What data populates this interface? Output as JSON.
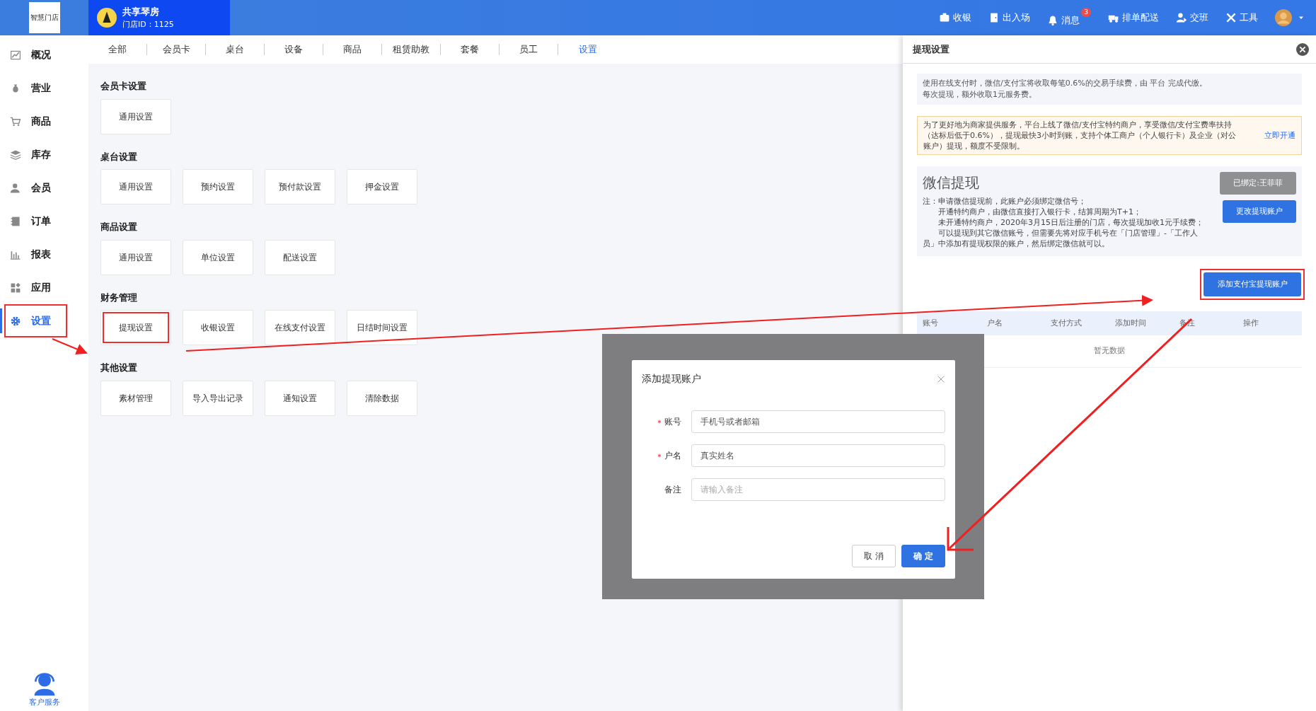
{
  "header": {
    "logo": "智慧门店",
    "store_name": "共享琴房",
    "store_id": "门店ID：1125",
    "tools": [
      {
        "label": "收银"
      },
      {
        "label": "出入场"
      },
      {
        "label": "消息",
        "badge": "3"
      },
      {
        "label": "排单配送"
      },
      {
        "label": "交班"
      },
      {
        "label": "工具"
      }
    ]
  },
  "sidebar": {
    "items": [
      {
        "label": "概况",
        "selected": false,
        "highlighted": false
      },
      {
        "label": "营业",
        "selected": false,
        "highlighted": false
      },
      {
        "label": "商品",
        "selected": false,
        "highlighted": false
      },
      {
        "label": "库存",
        "selected": false,
        "highlighted": false
      },
      {
        "label": "会员",
        "selected": false,
        "highlighted": false
      },
      {
        "label": "订单",
        "selected": false,
        "highlighted": false
      },
      {
        "label": "报表",
        "selected": false,
        "highlighted": false
      },
      {
        "label": "应用",
        "selected": false,
        "highlighted": false
      },
      {
        "label": "设置",
        "selected": true,
        "highlighted": true
      }
    ],
    "support": "客户服务"
  },
  "tabs": [
    {
      "label": "全部",
      "selected": false
    },
    {
      "label": "会员卡",
      "selected": false
    },
    {
      "label": "桌台",
      "selected": false
    },
    {
      "label": "设备",
      "selected": false
    },
    {
      "label": "商品",
      "selected": false
    },
    {
      "label": "租赁助教",
      "selected": false
    },
    {
      "label": "套餐",
      "selected": false
    },
    {
      "label": "员工",
      "selected": false
    },
    {
      "label": "设置",
      "selected": true
    }
  ],
  "sections": [
    {
      "title": "会员卡设置",
      "buttons": [
        {
          "label": "通用设置",
          "highlighted": false
        }
      ]
    },
    {
      "title": "桌台设置",
      "buttons": [
        {
          "label": "通用设置",
          "highlighted": false
        },
        {
          "label": "预约设置",
          "highlighted": false
        },
        {
          "label": "预付款设置",
          "highlighted": false
        },
        {
          "label": "押金设置",
          "highlighted": false
        }
      ]
    },
    {
      "title": "商品设置",
      "buttons": [
        {
          "label": "通用设置",
          "highlighted": false
        },
        {
          "label": "单位设置",
          "highlighted": false
        },
        {
          "label": "配送设置",
          "highlighted": false
        }
      ]
    },
    {
      "title": "财务管理",
      "buttons": [
        {
          "label": "提现设置",
          "highlighted": true
        },
        {
          "label": "收银设置",
          "highlighted": false
        },
        {
          "label": "在线支付设置",
          "highlighted": false
        },
        {
          "label": "日结时间设置",
          "highlighted": false
        }
      ]
    },
    {
      "title": "其他设置",
      "buttons": [
        {
          "label": "素材管理",
          "highlighted": false
        },
        {
          "label": "导入导出记录",
          "highlighted": false
        },
        {
          "label": "通知设置",
          "highlighted": false
        },
        {
          "label": "清除数据",
          "highlighted": false
        }
      ]
    }
  ],
  "drawer": {
    "title": "提现设置",
    "notice": [
      "使用在线支付时，微信/支付宝将收取每笔0.6%的交易手续费，由 平台 完成代缴。",
      "每次提现，额外收取1元服务费。"
    ],
    "promo": {
      "text": "为了更好地为商家提供服务，平台上线了微信/支付宝特约商户，享受微信/支付宝费率扶持（达标后低于0.6%），提现最快3小时到账，支持个体工商户（个人银行卡）及企业（对公账户）提现，额度不受限制。",
      "link": "立即开通"
    },
    "wechat": {
      "title": "微信提现",
      "notes": [
        "注：申请微信提现前，此账户必须绑定微信号；",
        "开通特约商户，由微信直接打入银行卡，结算周期为T+1；",
        "未开通特约商户，2020年3月15日后注册的门店，每次提现加收1元手续费；",
        "可以提现到其它微信账号，但需要先将对应手机号在「门店管理」-「工作人员」中添加有提现权限的账户，然后绑定微信就可以。"
      ],
      "bound_button": "已绑定:王菲菲",
      "change_button": "更改提现账户"
    },
    "add_button": {
      "label": "添加支付宝提现账户",
      "highlighted": true
    },
    "table": {
      "columns": [
        "账号",
        "户名",
        "支付方式",
        "添加时间",
        "备注",
        "操作"
      ],
      "empty": "暂无数据"
    }
  },
  "dialog": {
    "title": "添加提现账户",
    "fields": [
      {
        "label": "账号",
        "required": true,
        "value": "手机号或者邮箱"
      },
      {
        "label": "户名",
        "required": true,
        "value": "真实姓名"
      },
      {
        "label": "备注",
        "required": false,
        "placeholder": "请输入备注"
      }
    ],
    "buttons": [
      {
        "label": "取 消",
        "kind": "default"
      },
      {
        "label": "确 定",
        "kind": "primary"
      }
    ]
  }
}
